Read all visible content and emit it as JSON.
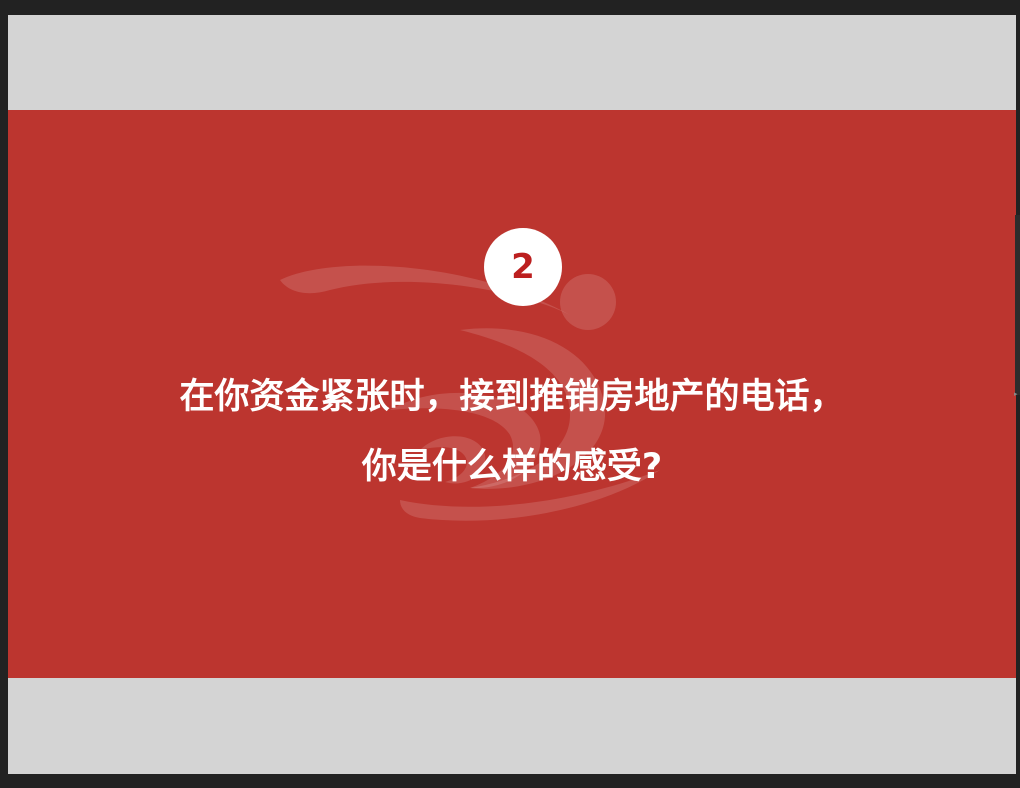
{
  "slide": {
    "number": "2",
    "question_line1": "在你资金紧张时，接到推销房地产的电话，",
    "question_line2": "你是什么样的感受?"
  },
  "colors": {
    "band": "#bc352f",
    "letterbox": "#d4d4d4",
    "number_text": "#bc1f1f",
    "text": "#ffffff"
  },
  "icons": {
    "watermark": "swirl-logo-icon",
    "caret": "caret-right-icon"
  }
}
